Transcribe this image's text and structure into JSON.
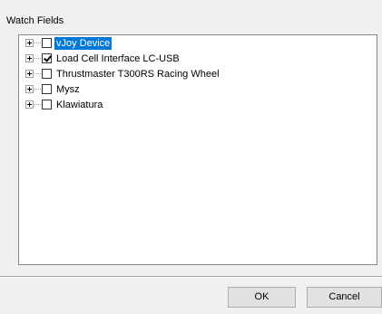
{
  "watch_fields": {
    "label": "Watch Fields",
    "devices": [
      {
        "label": "vJoy Device",
        "checked": false,
        "selected": true,
        "expandable": true
      },
      {
        "label": "Load Cell Interface LC-USB",
        "checked": true,
        "selected": false,
        "expandable": true
      },
      {
        "label": "Thrustmaster T300RS Racing Wheel",
        "checked": false,
        "selected": false,
        "expandable": true
      },
      {
        "label": "Mysz",
        "checked": false,
        "selected": false,
        "expandable": true
      },
      {
        "label": "Klawiatura",
        "checked": false,
        "selected": false,
        "expandable": true
      }
    ]
  },
  "buttons": {
    "ok_label": "OK",
    "cancel_label": "Cancel"
  },
  "colors": {
    "selection_background": "#0078d7",
    "selection_text": "#ffffff",
    "window_background": "#f0f0f0"
  }
}
